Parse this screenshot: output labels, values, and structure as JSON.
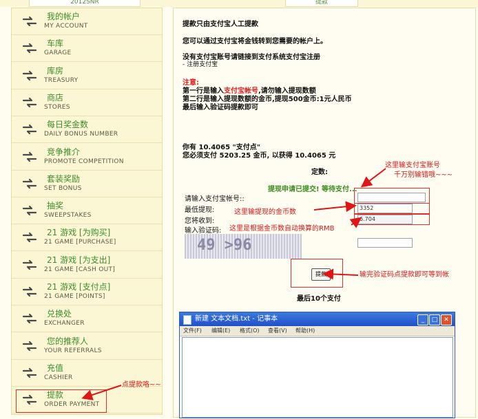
{
  "header": {
    "left_tab": "2012SNR",
    "right_tab": "提款"
  },
  "sidebar": {
    "items": [
      {
        "cn": "我的帐户",
        "en": "MY ACCOUNT"
      },
      {
        "cn": "车库",
        "en": "GARAGE"
      },
      {
        "cn": "库房",
        "en": "TREASURY"
      },
      {
        "cn": "商店",
        "en": "STORES"
      },
      {
        "cn": "每日奖金数",
        "en": "DAILY BONUS NUMBER"
      },
      {
        "cn": "竞争推介",
        "en": "PROMOTE COMPETITION"
      },
      {
        "cn": "套装奖励",
        "en": "SET BONUS"
      },
      {
        "cn": "抽奖",
        "en": "SWEEPSTAKES"
      },
      {
        "cn": "21 游戏 [为购买]",
        "en": "21 GAME [PURCHASE]"
      },
      {
        "cn": "21 游戏 [为支出]",
        "en": "21 GAME [CASH OUT]"
      },
      {
        "cn": "21 游戏 [支付点]",
        "en": "21 GAME [POINTS]"
      },
      {
        "cn": "兑换处",
        "en": "EXCHANGER"
      },
      {
        "cn": "您的推荐人",
        "en": "YOUR REFERRALS"
      },
      {
        "cn": "充值",
        "en": "CASHIER"
      },
      {
        "cn": "提款",
        "en": "ORDER PAYMENT"
      }
    ]
  },
  "main": {
    "heading": "提款只由支付宝人工提款",
    "line2": "您可以通过支付宝将金钱转到您需要的帐户上。",
    "line3": "没有支付宝账号请链接到支付系统支付宝注册",
    "register_link": "- 注册支付宝",
    "note_label": "注意:",
    "note1_a": "第一行是输入",
    "note1_b": "支付宝帐号",
    "note1_c": ",请勿输入提现数额",
    "note2": "第二行是输入提现数额的金币,提现500金币:1元人民币",
    "note3": "最后输入验证码提款即可",
    "balance1": "你有 10.4065 \"支付点\"",
    "balance2": "您必须支付 5203.25 金币, 以获得 10.4065 元",
    "fixed_label": "定数:",
    "submitted": "提现申请已提交! 等待支付...",
    "form": {
      "account_label": "请输入支付宝帐号::",
      "min_label": "最低提现:",
      "min_value": "3352",
      "receive_label": "您将收到:",
      "receive_value": "6.704",
      "captcha_label": "输入验证码:",
      "captcha_text": "49 >96"
    },
    "submit_button": "提款",
    "recent_label": "最后10个支付"
  },
  "annotations": {
    "a1_line1": "这里输支付宝账号",
    "a1_line2": "千万别输错哦~~~",
    "a2": "这里输提现的金币数",
    "a3": "这里是根据金币数自动换算的RMB",
    "a4": "输完验证码点提款即可等到帐",
    "a5": "点提款咯~~"
  },
  "notepad": {
    "title": "新建 文本文档.txt - 记事本",
    "menu": [
      "文件(F)",
      "编辑(E)",
      "格式(O)",
      "查看(V)",
      "帮助(H)"
    ]
  },
  "colors": {
    "accent_green": "#3f8e2c",
    "annotation_red": "#d41818",
    "sidebar_bg": "#fbf6d4"
  }
}
